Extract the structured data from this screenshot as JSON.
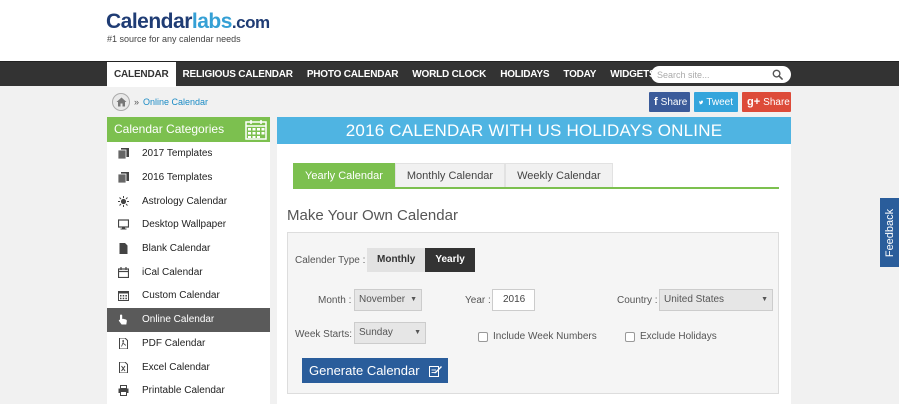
{
  "header": {
    "logo": {
      "part1": "Calendar",
      "part2": "labs",
      "part3": ".com"
    },
    "tagline": "#1 source for any calendar needs"
  },
  "nav": {
    "items": [
      "CALENDAR",
      "RELIGIOUS CALENDAR",
      "PHOTO CALENDAR",
      "WORLD CLOCK",
      "HOLIDAYS",
      "TODAY",
      "WIDGETS"
    ],
    "active": "CALENDAR",
    "search_placeholder": "Search site..."
  },
  "breadcrumb": {
    "separator": "»",
    "current": "Online Calendar"
  },
  "share": {
    "facebook": "Share",
    "twitter": "Tweet",
    "gplus": "Share",
    "fb_icon": "f",
    "gp_icon": "g+"
  },
  "sidebar": {
    "title": "Calendar Categories",
    "items": [
      {
        "label": "2017 Templates",
        "icon": "templates-icon"
      },
      {
        "label": "2016 Templates",
        "icon": "templates-icon"
      },
      {
        "label": "Astrology Calendar",
        "icon": "sun-icon"
      },
      {
        "label": "Desktop Wallpaper",
        "icon": "monitor-icon"
      },
      {
        "label": "Blank Calendar",
        "icon": "document-icon"
      },
      {
        "label": "iCal Calendar",
        "icon": "calendar-icon"
      },
      {
        "label": "Custom Calendar",
        "icon": "grid-calendar-icon"
      },
      {
        "label": "Online Calendar",
        "icon": "pointer-icon"
      },
      {
        "label": "PDF Calendar",
        "icon": "pdf-icon"
      },
      {
        "label": "Excel Calendar",
        "icon": "excel-icon"
      },
      {
        "label": "Printable Calendar",
        "icon": "printer-icon"
      }
    ],
    "active_index": 7
  },
  "main": {
    "title": "2016 CALENDAR WITH US HOLIDAYS ONLINE",
    "tabs": [
      "Yearly Calendar",
      "Monthly Calendar",
      "Weekly Calendar"
    ],
    "active_tab": "Yearly Calendar",
    "section_title": "Make Your Own Calendar",
    "form": {
      "calendar_type_label": "Calender Type :",
      "type_options": [
        "Monthly",
        "Yearly"
      ],
      "type_selected": "Yearly",
      "month_label": "Month :",
      "month_value": "November",
      "year_label": "Year :",
      "year_value": "2016",
      "country_label": "Country :",
      "country_value": "United States",
      "week_starts_label": "Week Starts:",
      "week_starts_value": "Sunday",
      "include_week_numbers": "Include Week Numbers",
      "exclude_holidays": "Exclude Holidays",
      "generate_button": "Generate Calendar"
    }
  },
  "feedback": "Feedback",
  "colors": {
    "green": "#7cc04f",
    "blue_title": "#4fb4e2",
    "dark_nav": "#333333",
    "button_blue": "#2a5d9b"
  }
}
